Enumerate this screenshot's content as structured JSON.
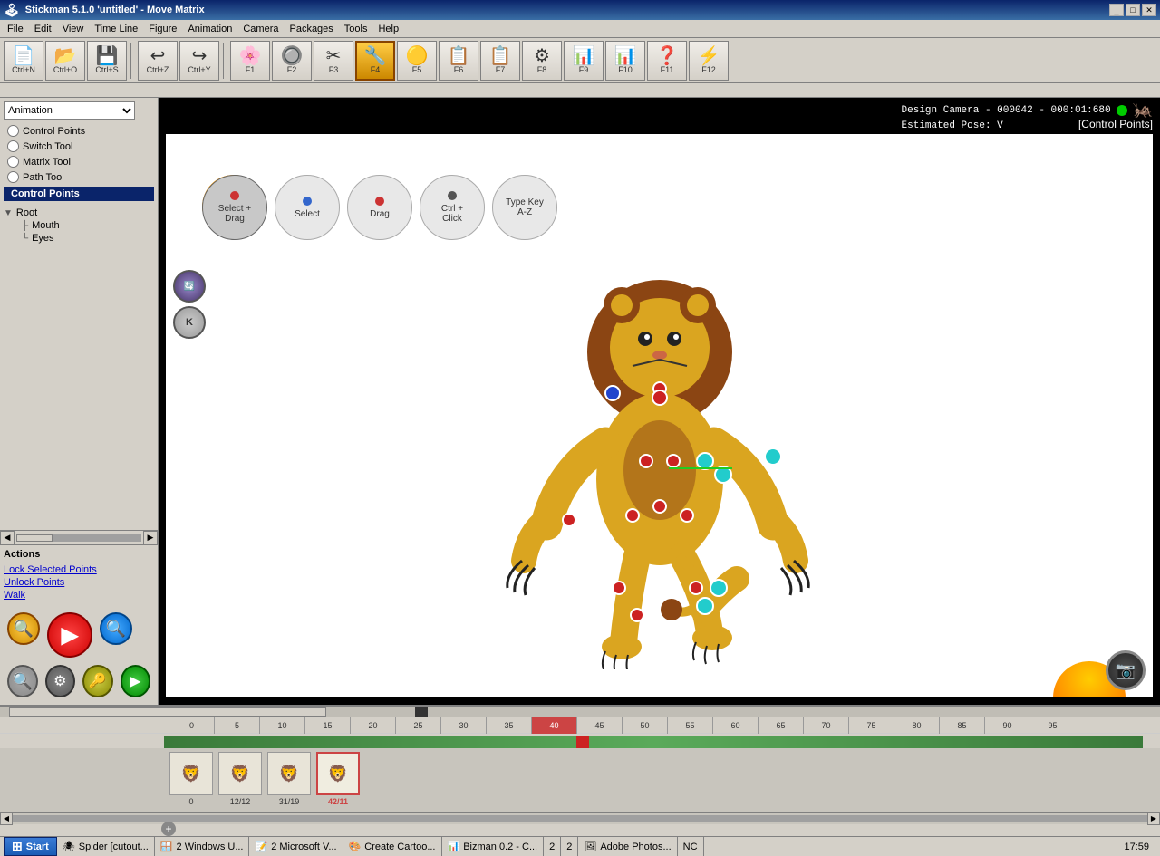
{
  "titlebar": {
    "title": "Stickman 5.1.0  'untitled' - Move Matrix",
    "controls": [
      "_",
      "□",
      "✕"
    ]
  },
  "menubar": {
    "items": [
      "File",
      "Edit",
      "View",
      "Time Line",
      "Figure",
      "Animation",
      "Camera",
      "Packages",
      "Tools",
      "Help"
    ]
  },
  "toolbar": {
    "buttons": [
      {
        "id": "new",
        "icon": "📄",
        "label": "Ctrl+N"
      },
      {
        "id": "open",
        "icon": "📂",
        "label": "Ctrl+O"
      },
      {
        "id": "save",
        "icon": "💾",
        "label": "Ctrl+S"
      },
      {
        "id": "undo",
        "icon": "↩",
        "label": "Ctrl+Z"
      },
      {
        "id": "redo",
        "icon": "↪",
        "label": "Ctrl+Y"
      },
      {
        "id": "f1",
        "icon": "🌸",
        "label": "F1"
      },
      {
        "id": "f2",
        "icon": "🔘",
        "label": "F2"
      },
      {
        "id": "f3",
        "icon": "✂",
        "label": "F3"
      },
      {
        "id": "f4",
        "icon": "🔧",
        "label": "F4"
      },
      {
        "id": "f5",
        "icon": "🟡",
        "label": "F5"
      },
      {
        "id": "f6",
        "icon": "📋",
        "label": "F6"
      },
      {
        "id": "f7",
        "icon": "📋",
        "label": "F7"
      },
      {
        "id": "f8",
        "icon": "⚙",
        "label": "F8"
      },
      {
        "id": "f9",
        "icon": "📊",
        "label": "F9"
      },
      {
        "id": "f10",
        "icon": "📊",
        "label": "F10"
      },
      {
        "id": "f11",
        "icon": "❓",
        "label": "F11"
      },
      {
        "id": "f12",
        "icon": "⚡",
        "label": "F12"
      }
    ]
  },
  "leftpanel": {
    "animation_dropdown": "Animation",
    "tools": [
      {
        "id": "control-points",
        "label": "Control Points",
        "active": false
      },
      {
        "id": "switch-tool",
        "label": "Switch Tool",
        "active": false
      },
      {
        "id": "matrix-tool",
        "label": "Matrix Tool",
        "active": false
      },
      {
        "id": "path-tool",
        "label": "Path Tool",
        "active": false
      }
    ],
    "active_section": "Control Points",
    "tree": {
      "root": "Root",
      "children": [
        "Mouth",
        "Eyes"
      ]
    },
    "actions": {
      "label": "Actions",
      "items": [
        "Lock Selected Points",
        "Unlock Points",
        "Walk"
      ]
    }
  },
  "canvas": {
    "camera_info": "Design Camera - 000042 - 000:01:680",
    "estimated_pose": "Estimated Pose: V",
    "control_points_label": "[Control Points]",
    "tool_hints": [
      {
        "label": "Select +\nDrag",
        "dot": "red",
        "active": true
      },
      {
        "label": "Select",
        "dot": "none",
        "active": false
      },
      {
        "label": "Drag",
        "dot": "red",
        "active": false
      },
      {
        "label": "Ctrl +\nClick",
        "dot": "none",
        "active": false
      },
      {
        "label": "Type Key\nA-Z",
        "dot": "none",
        "active": false
      }
    ]
  },
  "timeline": {
    "ruler_marks": [
      0,
      5,
      10,
      15,
      20,
      25,
      30,
      35,
      40,
      45,
      50,
      55,
      60,
      65,
      70,
      75,
      80,
      85,
      90,
      95
    ],
    "frames": [
      {
        "icon": "🦁",
        "top_label": "0",
        "bottom_label": ""
      },
      {
        "icon": "🦁",
        "top_label": "12/12",
        "bottom_label": ""
      },
      {
        "icon": "🦁",
        "top_label": "31/19",
        "bottom_label": ""
      },
      {
        "icon": "🦁",
        "top_label": "42/11",
        "bottom_label": "",
        "active": true
      }
    ]
  },
  "statusbar": {
    "start_label": "Start",
    "items": [
      "Spider [cutout...",
      "2 Windows U...",
      "2 Microsoft V...",
      "Create Cartoo...",
      "Bizman 0.2 - C...",
      "2",
      "2",
      "Adobe Photos...",
      "NC",
      "17:59"
    ]
  }
}
